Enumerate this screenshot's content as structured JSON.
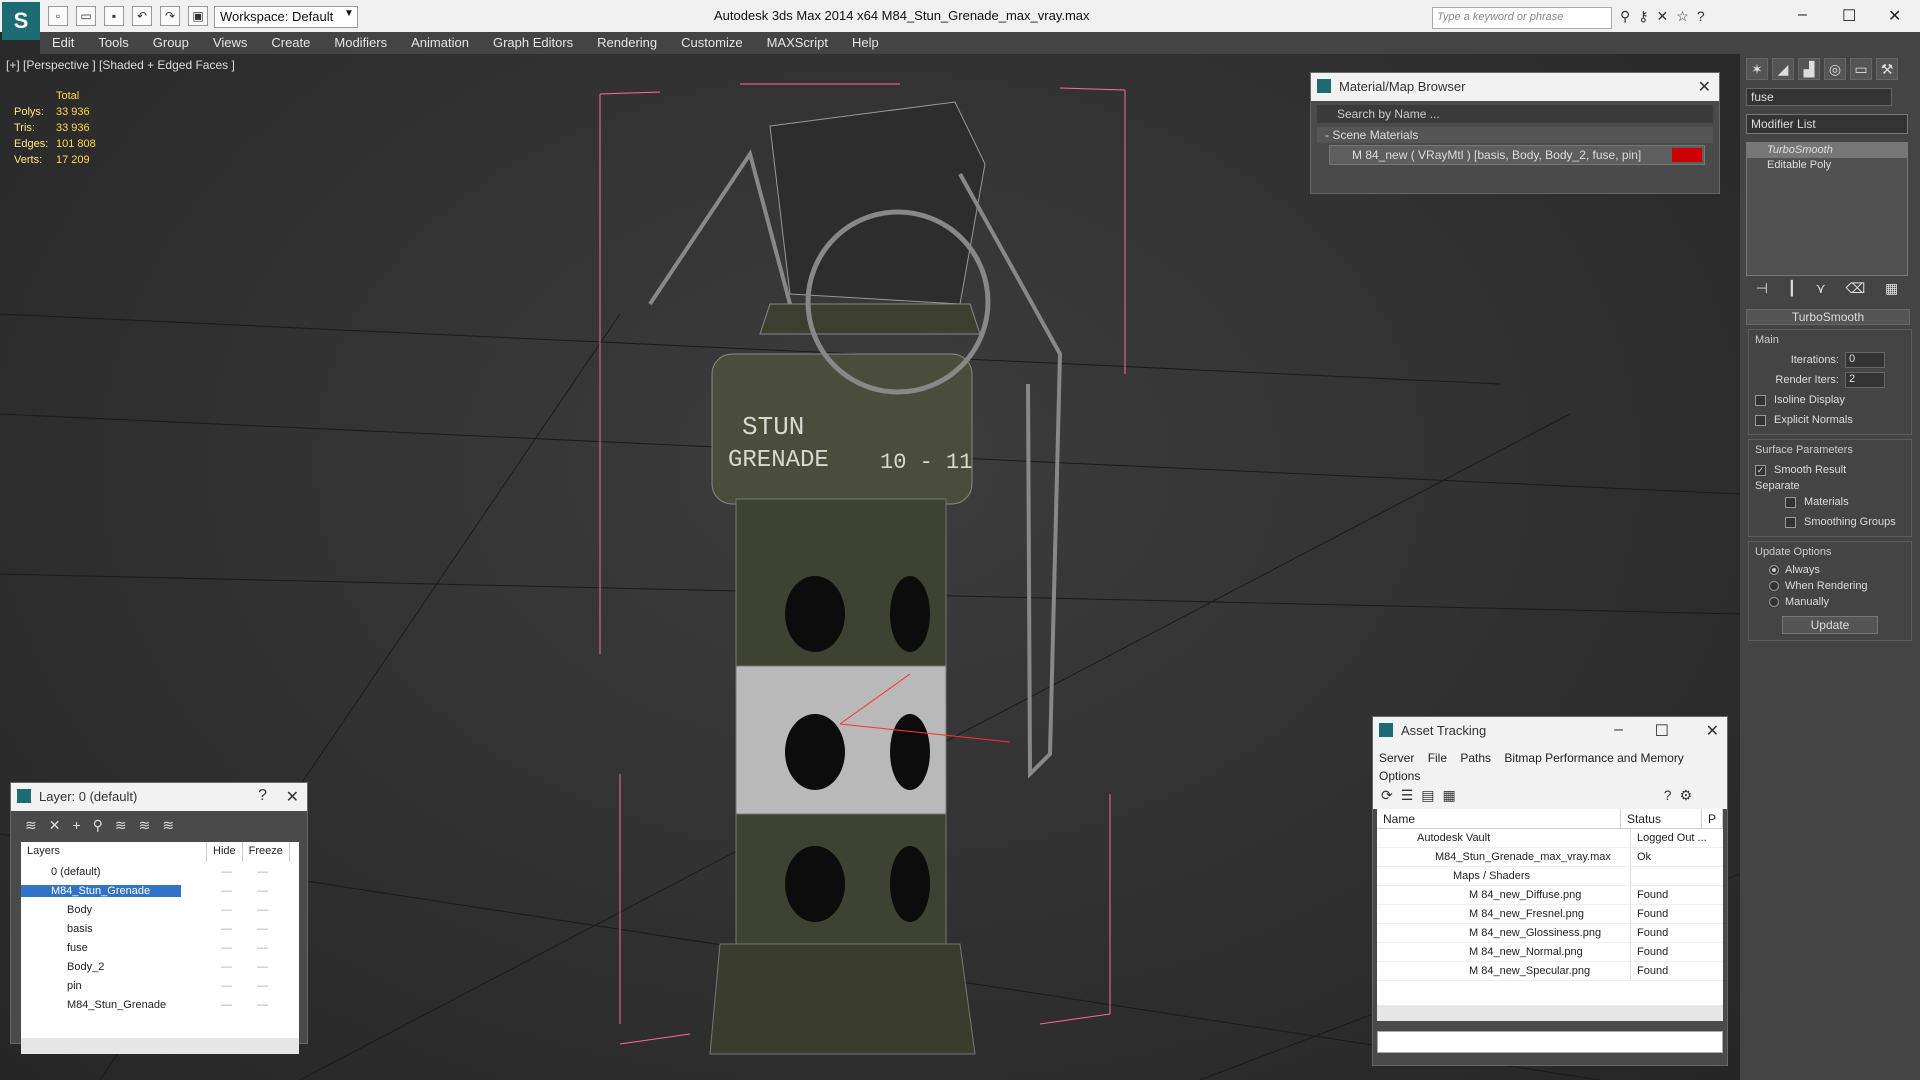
{
  "window": {
    "title": "Autodesk 3ds Max  2014 x64       M84_Stun_Grenade_max_vray.max",
    "workspace": "Workspace: Default",
    "search_placeholder": "Type a keyword or phrase"
  },
  "menu": [
    "Edit",
    "Tools",
    "Group",
    "Views",
    "Create",
    "Modifiers",
    "Animation",
    "Graph Editors",
    "Rendering",
    "Customize",
    "MAXScript",
    "Help"
  ],
  "viewport": {
    "label": "[+] [Perspective ] [Shaded + Edged Faces ]",
    "stats": {
      "total_label": "Total",
      "rows": [
        {
          "k": "Polys:",
          "v": "33 936"
        },
        {
          "k": "Tris:",
          "v": "33 936"
        },
        {
          "k": "Edges:",
          "v": "101 808"
        },
        {
          "k": "Verts:",
          "v": "17 209"
        }
      ]
    },
    "decal": {
      "line1": "STUN",
      "line2": "GRENADE",
      "code": "10 - 11"
    }
  },
  "material_browser": {
    "title": "Material/Map Browser",
    "search": "Search by Name ...",
    "section": "- Scene Materials",
    "item": "M 84_new  ( VRayMtl )  [basis, Body, Body_2, fuse, pin]"
  },
  "command_panel": {
    "object_name": "fuse",
    "modifier_list": "Modifier List",
    "stack": [
      "TurboSmooth",
      "Editable Poly"
    ],
    "rollout": "TurboSmooth",
    "main": {
      "title": "Main",
      "iterations_label": "Iterations:",
      "iterations": "0",
      "render_iters_label": "Render Iters:",
      "render_iters": "2"
    },
    "checks": {
      "isoline": "Isoline Display",
      "explicit": "Explicit Normals"
    },
    "surface": {
      "title": "Surface Parameters",
      "smooth": "Smooth Result",
      "separate": "Separate",
      "materials": "Materials",
      "smoothing": "Smoothing Groups"
    },
    "update": {
      "title": "Update Options",
      "always": "Always",
      "when": "When Rendering",
      "manually": "Manually",
      "button": "Update"
    }
  },
  "layer_panel": {
    "title": "Layer: 0 (default)",
    "headers": [
      "Layers",
      "Hide",
      "Freeze"
    ],
    "rows": [
      {
        "name": "0 (default)"
      },
      {
        "name": "M84_Stun_Grenade"
      },
      {
        "name": "Body"
      },
      {
        "name": "basis"
      },
      {
        "name": "fuse"
      },
      {
        "name": "Body_2"
      },
      {
        "name": "pin"
      },
      {
        "name": "M84_Stun_Grenade"
      }
    ]
  },
  "asset_tracking": {
    "title": "Asset Tracking",
    "menu": [
      "Server",
      "File",
      "Paths",
      "Bitmap Performance and Memory",
      "Options"
    ],
    "headers": [
      "Name",
      "Status",
      "P"
    ],
    "rows": [
      {
        "name": "Autodesk Vault",
        "status": "Logged Out ..."
      },
      {
        "name": "M84_Stun_Grenade_max_vray.max",
        "status": "Ok"
      },
      {
        "name": "Maps / Shaders",
        "status": ""
      },
      {
        "name": "M 84_new_Diffuse.png",
        "status": "Found"
      },
      {
        "name": "M 84_new_Fresnel.png",
        "status": "Found"
      },
      {
        "name": "M 84_new_Glossiness.png",
        "status": "Found"
      },
      {
        "name": "M 84_new_Normal.png",
        "status": "Found"
      },
      {
        "name": "M 84_new_Specular.png",
        "status": "Found"
      }
    ]
  }
}
